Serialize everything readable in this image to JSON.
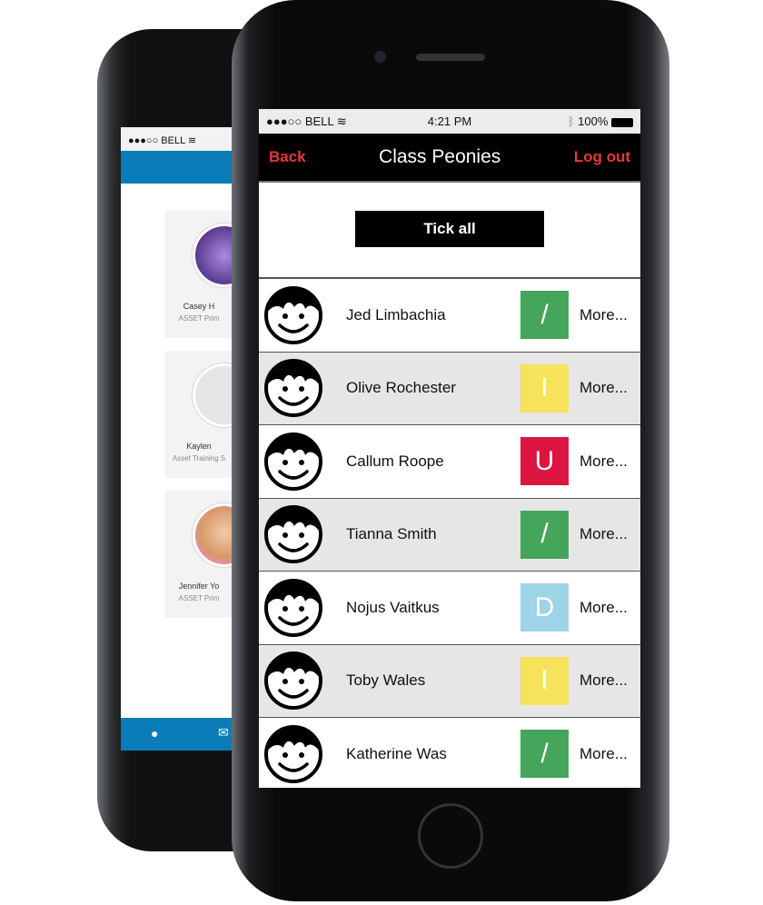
{
  "back_phone": {
    "status": {
      "carrier": "●●●○○ BELL",
      "wifi_icon": "wifi-icon"
    },
    "cards": [
      {
        "name": "Casey H",
        "subtitle": "ASSET Prim"
      },
      {
        "name": "Kaylen",
        "subtitle": "Asset Training S"
      },
      {
        "name": "Jennifer Yo",
        "subtitle": "ASSET Prim"
      }
    ],
    "tab_icons": [
      "user-icon",
      "mail-icon"
    ]
  },
  "status_bar": {
    "carrier": "●●●○○ BELL",
    "time": "4:21 PM",
    "battery": "100%"
  },
  "nav": {
    "back": "Back",
    "title": "Class Peonies",
    "logout": "Log out"
  },
  "tick_all": "Tick all",
  "colors": {
    "present": "#45a55a",
    "late": "#f7e25c",
    "unauthorised": "#dc1440",
    "other": "#9ed3e8",
    "nav_link": "#e8373a"
  },
  "students": [
    {
      "name": "Jed Limbachia",
      "mark": "/",
      "color": "#45a55a",
      "more": "More..."
    },
    {
      "name": "Olive Rochester",
      "mark": "I",
      "color": "#f7e25c",
      "more": "More..."
    },
    {
      "name": "Callum Roope",
      "mark": "U",
      "color": "#dc1440",
      "more": "More..."
    },
    {
      "name": "Tianna Smith",
      "mark": "/",
      "color": "#45a55a",
      "more": "More..."
    },
    {
      "name": "Nojus Vaitkus",
      "mark": "D",
      "color": "#9ed3e8",
      "more": "More..."
    },
    {
      "name": "Toby Wales",
      "mark": "I",
      "color": "#f7e25c",
      "more": "More..."
    },
    {
      "name": "Katherine Was",
      "mark": "/",
      "color": "#45a55a",
      "more": "More..."
    }
  ]
}
